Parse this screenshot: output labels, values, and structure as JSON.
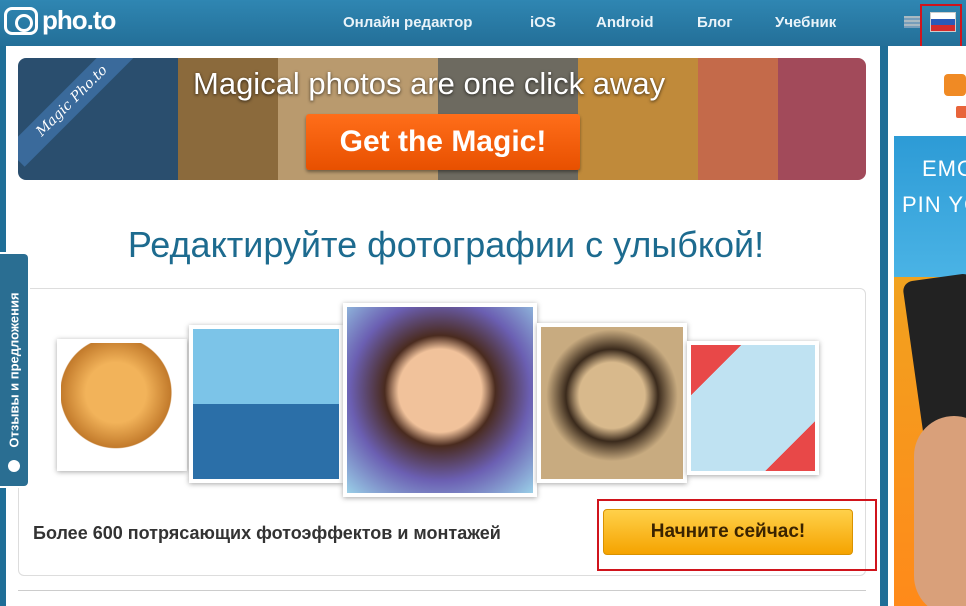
{
  "header": {
    "logo_text": "pho.to",
    "nav": [
      {
        "label": "Онлайн редактор"
      },
      {
        "label": "iOS"
      },
      {
        "label": "Android"
      },
      {
        "label": "Блог"
      },
      {
        "label": "Учебник"
      }
    ]
  },
  "banner": {
    "badge": "Magic Pho.to",
    "headline": "Magical photos are one click away",
    "button": "Get the Magic!"
  },
  "main": {
    "heading": "Редактируйте фотографии с улыбкой!",
    "caption": "Более 600 потрясающих фотоэффектов и монтажей",
    "start_button": "Начните сейчас!"
  },
  "feedback_tab": "Отзывы и предложения",
  "ad": {
    "line1": "EMOT",
    "line2": "PIN YO"
  }
}
